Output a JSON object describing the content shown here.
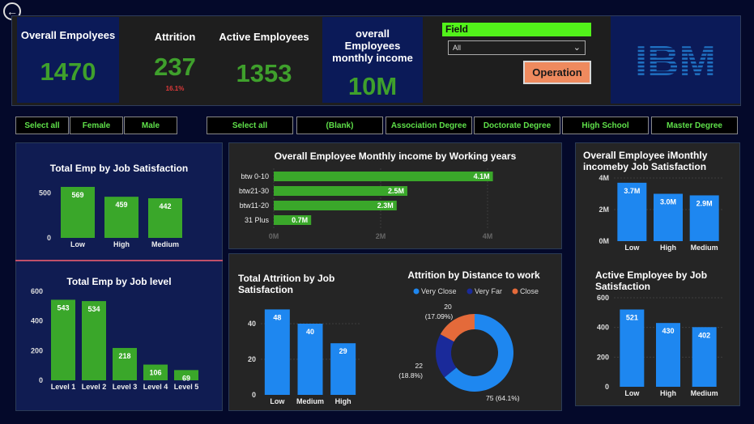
{
  "kpis": {
    "overall": {
      "title": "Overall Empolyees",
      "value": "1470"
    },
    "attrition": {
      "title": "Attrition",
      "value": "237",
      "sub": "16.1%"
    },
    "active": {
      "title": "Active Employees",
      "value": "1353"
    },
    "income": {
      "title": "overall Employees monthly income",
      "value": "10M"
    }
  },
  "field_slicer": {
    "label": "Field",
    "selected": "All"
  },
  "operation_label": "Operation",
  "logo_text": "IBM",
  "gender_slicer": [
    "Select all",
    "Female",
    "Male"
  ],
  "education_slicer": [
    "Select all",
    "(Blank)",
    "Association Degree",
    "Doctorate Degree",
    "High School",
    "Master Degree"
  ],
  "colors": {
    "green": "#3aa72a",
    "blue": "#1e87f0",
    "orange": "#e46a3a",
    "navy": "#101c52",
    "dark": "#252525"
  },
  "chart_data": [
    {
      "id": "job_sat",
      "type": "bar",
      "title": "Total Emp by Job Satisfaction",
      "categories": [
        "Low",
        "High",
        "Medium"
      ],
      "values": [
        569,
        459,
        442
      ],
      "ylim": [
        0,
        650
      ],
      "yticks": [
        0,
        500
      ]
    },
    {
      "id": "job_level",
      "type": "bar",
      "title": "Total Emp by Job level",
      "categories": [
        "Level 1",
        "Level 2",
        "Level 3",
        "Level 4",
        "Level 5"
      ],
      "values": [
        543,
        534,
        218,
        106,
        69
      ],
      "ylim": [
        0,
        600
      ],
      "yticks": [
        0,
        200,
        400,
        600
      ]
    },
    {
      "id": "income_years",
      "type": "bar",
      "orientation": "horizontal",
      "title": "Overall Employee Monthly income by Working years",
      "categories": [
        "btw 0-10",
        "btw21-30",
        "btw11-20",
        "31 Plus"
      ],
      "values": [
        4.1,
        2.5,
        2.3,
        0.7
      ],
      "value_labels": [
        "4.1M",
        "2.5M",
        "2.3M",
        "0.7M"
      ],
      "xlim": [
        0,
        4
      ],
      "xticks": [
        "0M",
        "2M",
        "4M"
      ]
    },
    {
      "id": "income_sat",
      "type": "bar",
      "title": "Overall Employee iMonthly incomeby Job Satisfaction",
      "categories": [
        "Low",
        "High",
        "Medium"
      ],
      "values": [
        3.7,
        3.0,
        2.9
      ],
      "value_labels": [
        "3.7M",
        "3.0M",
        "2.9M"
      ],
      "ylim": [
        0,
        4
      ],
      "yticks": [
        "0M",
        "2M",
        "4M"
      ]
    },
    {
      "id": "attr_sat",
      "type": "bar",
      "title": "Total Attrition by Job Satisfaction",
      "categories": [
        "Low",
        "Medium",
        "High"
      ],
      "values": [
        48,
        40,
        29
      ],
      "ylim": [
        0,
        50
      ],
      "yticks": [
        0,
        20,
        40
      ]
    },
    {
      "id": "distance",
      "type": "pie",
      "title": "Attrition by Distance to work",
      "legend": [
        "Very Close",
        "Very Far",
        "Close"
      ],
      "values": [
        75,
        22,
        20
      ],
      "labels": [
        "75 (64.1%)",
        "22 (18.8%)",
        "20 (17.09%)"
      ]
    },
    {
      "id": "active_sat",
      "type": "bar",
      "title": "Active Employee by Job Satisfaction",
      "categories": [
        "Low",
        "High",
        "Medium"
      ],
      "values": [
        521,
        430,
        402
      ],
      "ylim": [
        0,
        600
      ],
      "yticks": [
        0,
        200,
        400,
        600
      ]
    }
  ]
}
